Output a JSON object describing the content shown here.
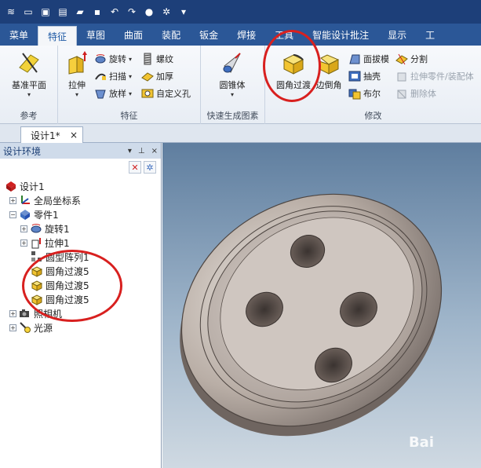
{
  "ribbon_tabs": [
    "菜单",
    "特征",
    "草图",
    "曲面",
    "装配",
    "钣金",
    "焊接",
    "工具",
    "智能设计批注",
    "显示",
    "工"
  ],
  "active_tab_index": 1,
  "groups": {
    "ref": {
      "label": "参考",
      "plane": "基准平面"
    },
    "feature": {
      "label": "特征",
      "extrude": "拉伸",
      "revolve": "旋转",
      "sweep": "扫描",
      "loft": "放样",
      "thread": "螺纹",
      "thicken": "加厚",
      "custom_hole": "自定义孔"
    },
    "quick": {
      "label": "快速生成图素",
      "cone": "圆锥体"
    },
    "modify": {
      "label": "修改",
      "fillet": "圆角过渡",
      "chamfer": "边倒角",
      "face_draft": "面拔模",
      "shell": "抽壳",
      "boolean": "布尔",
      "split": "分割",
      "extrude_part": "拉伸零件/装配体",
      "delete_body": "删除体"
    }
  },
  "document_tab": {
    "title": "设计1*",
    "close": "×"
  },
  "panel": {
    "title": "设计环境",
    "pin": "▾",
    "dock": "⊥",
    "close": "×"
  },
  "tree": {
    "root": "设计1",
    "global_coords": "全局坐标系",
    "part": "零件1",
    "revolve": "旋转1",
    "extrude": "拉伸1",
    "pattern": "圆型阵列1",
    "fillets": [
      "圆角过渡5",
      "圆角过渡5",
      "圆角过渡5"
    ],
    "camera": "照相机",
    "light": "光源"
  },
  "watermark": "Bai",
  "colors": {
    "title_bar": "#1d3f79",
    "tab_bar": "#2b5797",
    "highlight_circle": "#d8201f"
  }
}
